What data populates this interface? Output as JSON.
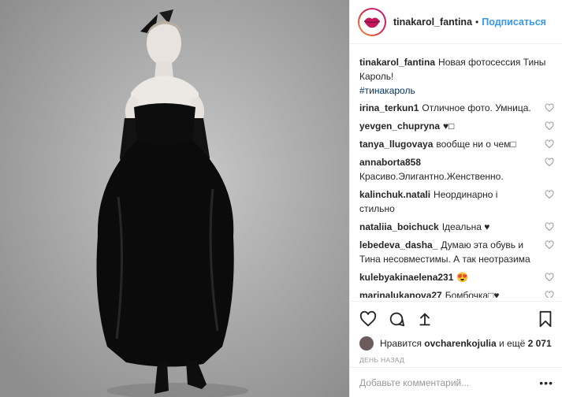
{
  "header": {
    "username": "tinakarol_fantina",
    "separator": "•",
    "follow_label": "Подписаться"
  },
  "caption": {
    "username": "tinakarol_fantina",
    "text": "Новая фотосессия Тины Кароль!",
    "hashtag": "#тинакароль"
  },
  "comments": [
    {
      "user": "irina_terkun1",
      "text": "Отличное фото. Умница."
    },
    {
      "user": "yevgen_chupryna",
      "text": "♥□"
    },
    {
      "user": "tanya_llugovaya",
      "text": "вообще ни о чем□"
    },
    {
      "user": "annaborta858",
      "text": "Красиво.Элигантно.Женственно."
    },
    {
      "user": "kalinchuk.natali",
      "text": "Неординарно і стильно"
    },
    {
      "user": "nataliia_boichuck",
      "text": "Ідеальна ♥"
    },
    {
      "user": "lebedeva_dasha_",
      "text": "Думаю эта обувь и Тина несовместимы. А так неотразима"
    },
    {
      "user": "kulebyakinaelena231",
      "text": "😍"
    },
    {
      "user": "marinalukanova27",
      "text": "Бомбочка□♥"
    }
  ],
  "likes": {
    "prefix": "Нравится",
    "user": "ovcharenkojulia",
    "middle": "и ещё",
    "count": "2 071"
  },
  "date": "ДЕНЬ НАЗАД",
  "add_comment": {
    "placeholder": "Добавьте комментарий...",
    "more": "•••"
  },
  "icons": {
    "like": "heart-outline-icon",
    "comment": "comment-bubble-icon",
    "share": "share-arrow-icon",
    "save": "bookmark-icon"
  }
}
